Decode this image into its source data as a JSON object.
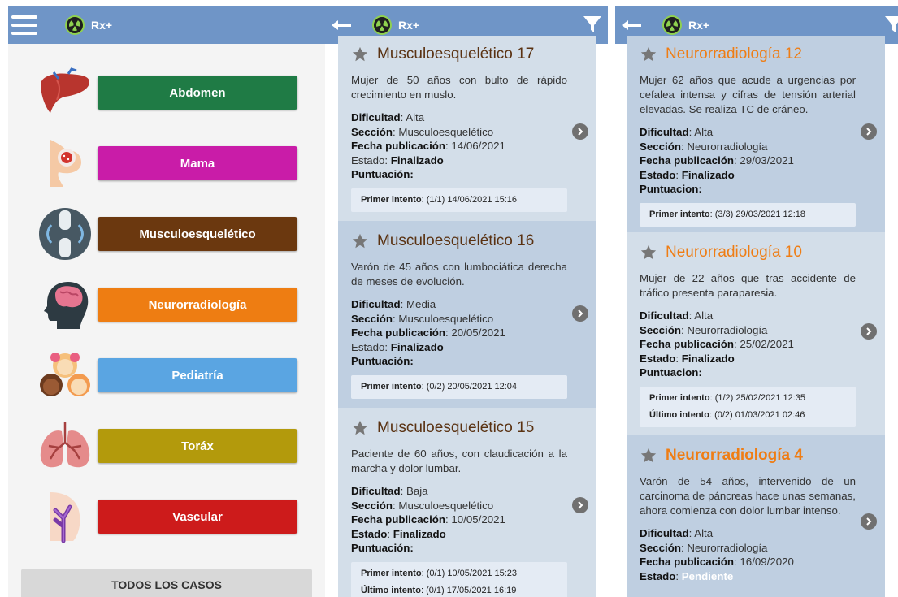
{
  "app": {
    "name": "Rx+"
  },
  "home": {
    "categories": [
      {
        "label": "Abdomen",
        "color": "#1f7b45",
        "icon": "liver-icon"
      },
      {
        "label": "Mama",
        "color": "#c91ca8",
        "icon": "breast-icon"
      },
      {
        "label": "Musculoesquelético",
        "color": "#6b380f",
        "icon": "knee-joint-icon"
      },
      {
        "label": "Neurorradiología",
        "color": "#ee7d12",
        "icon": "brain-head-icon"
      },
      {
        "label": "Pediatría",
        "color": "#5aa5e2",
        "icon": "children-icon"
      },
      {
        "label": "Toráx",
        "color": "#b39a0c",
        "icon": "lungs-icon"
      },
      {
        "label": "Vascular",
        "color": "#cd1b1b",
        "icon": "vessel-icon"
      }
    ],
    "all_cases": "TODOS LOS CASOS"
  },
  "labels": {
    "dificultad": "Dificultad",
    "seccion": "Sección",
    "fecha": "Fecha publicación",
    "estado": "Estado",
    "puntuacion_p2": "Puntuación:",
    "puntuacion_p3": "Puntuacion:",
    "primer": "Primer intento",
    "ultimo": "Último intento"
  },
  "list_musculo": [
    {
      "title": "Musculoesquelético 17",
      "desc": "Mujer de 50 años con bulto de rápido crecimiento en muslo.",
      "dificultad": "Alta",
      "seccion": "Musculoesquelético",
      "fecha": "14/06/2021",
      "estado": "Finalizado",
      "primer": "(1/1) 14/06/2021 15:16",
      "ultimo": ""
    },
    {
      "title": "Musculoesquelético 16",
      "desc": "Varón de 45 años con lumbociática derecha de meses de evolución.",
      "dificultad": "Media",
      "seccion": "Musculoesquelético",
      "fecha": "20/05/2021",
      "estado": "Finalizado",
      "primer": "(0/2) 20/05/2021 12:04",
      "ultimo": ""
    },
    {
      "title": "Musculoesquelético 15",
      "desc": "Paciente de 60 años, con claudicación a la marcha y dolor lumbar.",
      "dificultad": "Baja",
      "seccion": "Musculoesquelético",
      "fecha": "10/05/2021",
      "estado": "Finalizado",
      "primer": "(0/1) 10/05/2021 15:23",
      "ultimo": "(0/1) 17/05/2021 16:19"
    }
  ],
  "list_neuro": [
    {
      "title": "Neurorradiología 12",
      "desc": "Mujer 62 años que acude a urgencias por cefalea intensa y cifras de tensión arterial elevadas. Se realiza TC de cráneo.",
      "dificultad": "Alta",
      "seccion": "Neurorradiología",
      "fecha": "29/03/2021",
      "estado": "Finalizado",
      "primer": "(3/3) 29/03/2021 12:18",
      "ultimo": ""
    },
    {
      "title": "Neurorradiología 10",
      "desc": "Mujer de 22 años que tras accidente de tráfico presenta paraparesia.",
      "dificultad": "Alta",
      "seccion": "Neurorradiología",
      "fecha": "25/02/2021",
      "estado": "Finalizado",
      "primer": "(1/2) 25/02/2021 12:35",
      "ultimo": "(0/2) 01/03/2021 02:46"
    },
    {
      "title": "Neurorradiología 4",
      "desc": "Varón de 54 años, intervenido de un carcinoma de páncreas hace unas semanas, ahora comienza con dolor lumbar intenso.",
      "dificultad": "Alta",
      "seccion": "Neurorradiología",
      "fecha": "16/09/2020",
      "estado": "Pendiente",
      "primer": "",
      "ultimo": ""
    }
  ]
}
